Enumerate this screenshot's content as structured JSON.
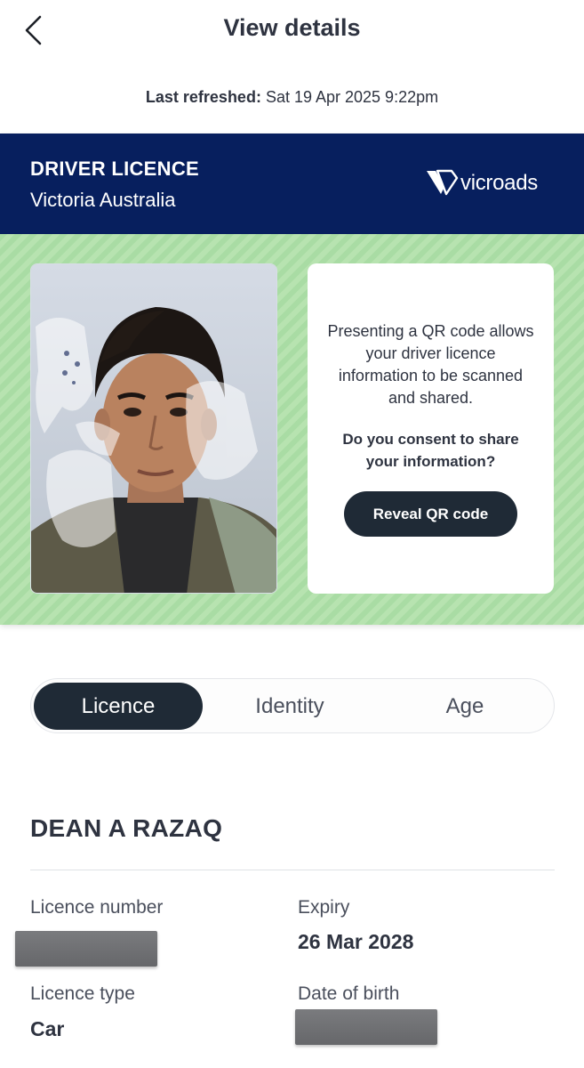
{
  "header": {
    "back_icon": "chevron-left-icon",
    "title": "View details"
  },
  "refresh": {
    "label": "Last refreshed:",
    "value": "Sat 19 Apr 2025 9:22pm"
  },
  "card": {
    "kicker": "DRIVER LICENCE",
    "state": "Victoria Australia",
    "logo_text": "vicroads",
    "header_color": "#071f5e",
    "pattern_color": "#a9dca4",
    "consent": {
      "info": "Presenting a QR code allows your driver licence information to be scanned and shared.",
      "question": "Do you consent to share your information?",
      "button": "Reveal QR code"
    }
  },
  "tabs": [
    {
      "label": "Licence",
      "active": true
    },
    {
      "label": "Identity",
      "active": false
    },
    {
      "label": "Age",
      "active": false
    }
  ],
  "holder": {
    "name": "DEAN A RAZAQ"
  },
  "fields": {
    "licence_number": {
      "label": "Licence number",
      "value": ""
    },
    "expiry": {
      "label": "Expiry",
      "value": "26 Mar 2028"
    },
    "licence_type": {
      "label": "Licence type",
      "value": "Car"
    },
    "date_of_birth": {
      "label": "Date of birth",
      "value": ""
    }
  },
  "accent_colors": {
    "button_dark": "#1f2a36",
    "text_dark": "#2e3340"
  }
}
